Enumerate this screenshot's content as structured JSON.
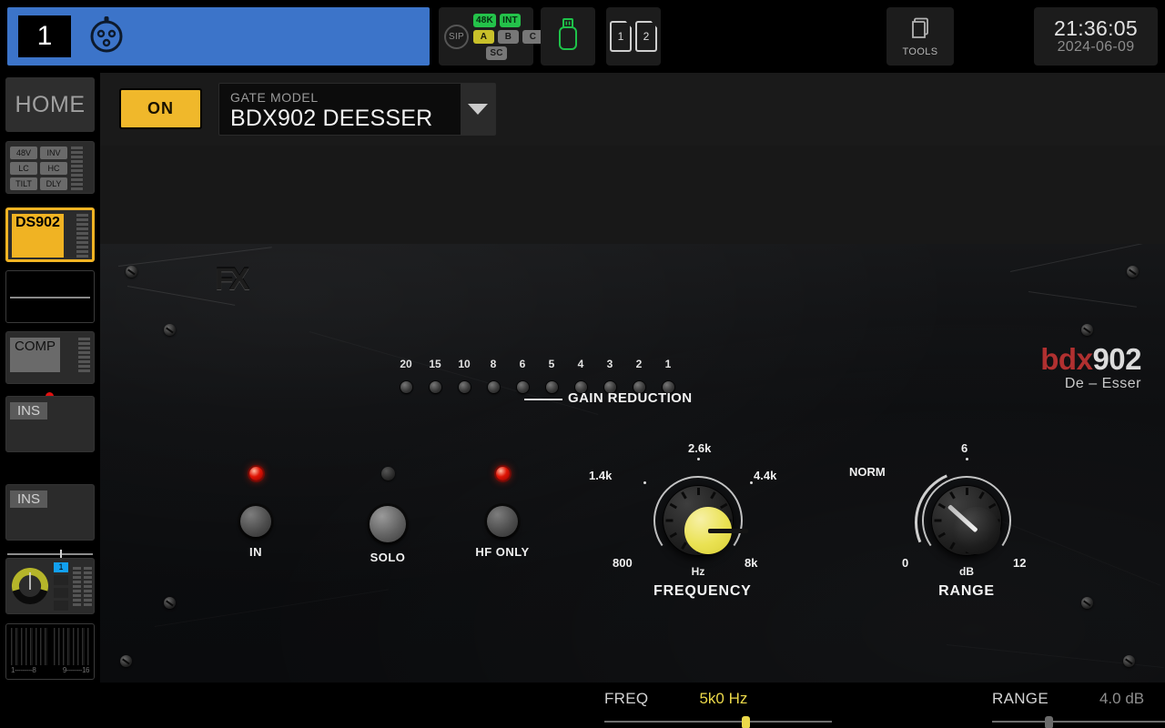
{
  "topbar": {
    "channel": {
      "number": "1",
      "icon": "xlr-connector-icon"
    },
    "status": {
      "sip": "SIP",
      "badges": [
        {
          "label": "48K",
          "state": "green"
        },
        {
          "label": "INT",
          "state": "green"
        },
        {
          "label": "A",
          "state": "olive"
        },
        {
          "label": "B",
          "state": "gray"
        },
        {
          "label": "C",
          "state": "gray"
        },
        {
          "label": "SC",
          "state": "gray"
        }
      ]
    },
    "usb_icon": "usb-drive-icon",
    "cards": [
      "1",
      "2"
    ],
    "tools_label": "TOOLS",
    "clock": {
      "time": "21:36:05",
      "date": "2024-06-09"
    }
  },
  "sidebar": {
    "home_label": "HOME",
    "preamp_badges": [
      "48V",
      "INV",
      "LC",
      "HC",
      "TILT",
      "DLY"
    ],
    "ds_label": "DS902",
    "comp_label": "COMP",
    "ins1_label": "INS",
    "ins2_label": "INS",
    "bus_label": "1",
    "meter_left_label": "1---------8",
    "meter_right_label": "9--------16"
  },
  "header": {
    "on_label": "ON",
    "model_title": "GATE MODEL",
    "model_value": "BDX902 DEESSER"
  },
  "rack": {
    "fx_logo": "FX",
    "brand_left": "bdx",
    "brand_right": "902",
    "brand_sub": "De – Esser",
    "gain_reduction": {
      "label": "GAIN REDUCTION",
      "scale": [
        "20",
        "15",
        "10",
        "8",
        "6",
        "5",
        "4",
        "3",
        "2",
        "1"
      ],
      "lit": [
        false,
        false,
        false,
        false,
        false,
        false,
        false,
        false,
        false,
        false
      ]
    },
    "buttons": [
      {
        "name": "IN",
        "led": true
      },
      {
        "name": "SOLO",
        "led": false
      },
      {
        "name": "HF ONLY",
        "led": true
      }
    ],
    "frequency_knob": {
      "caption": "FREQUENCY",
      "unit": "Hz",
      "ticks": [
        "800",
        "1.4k",
        "2.6k",
        "4.4k",
        "8k"
      ],
      "value": "5k0 Hz",
      "angle_deg": 90
    },
    "range_knob": {
      "caption": "RANGE",
      "unit": "dB",
      "norm_label": "NORM",
      "ticks": [
        "0",
        "6",
        "12"
      ],
      "value": "4.0 dB",
      "angle_deg": -47
    }
  },
  "bottom": {
    "controls": [
      {
        "name": "FREQ",
        "value": "5k0 Hz",
        "active": true,
        "pos_pct": 62
      },
      {
        "name": "RANGE",
        "value": "4.0 dB",
        "active": false,
        "pos_pct": 33
      }
    ]
  },
  "colors": {
    "accent_yellow": "#f0b323",
    "banner_blue": "#3c74c9",
    "led_red": "#e01505",
    "green": "#24c24a"
  }
}
